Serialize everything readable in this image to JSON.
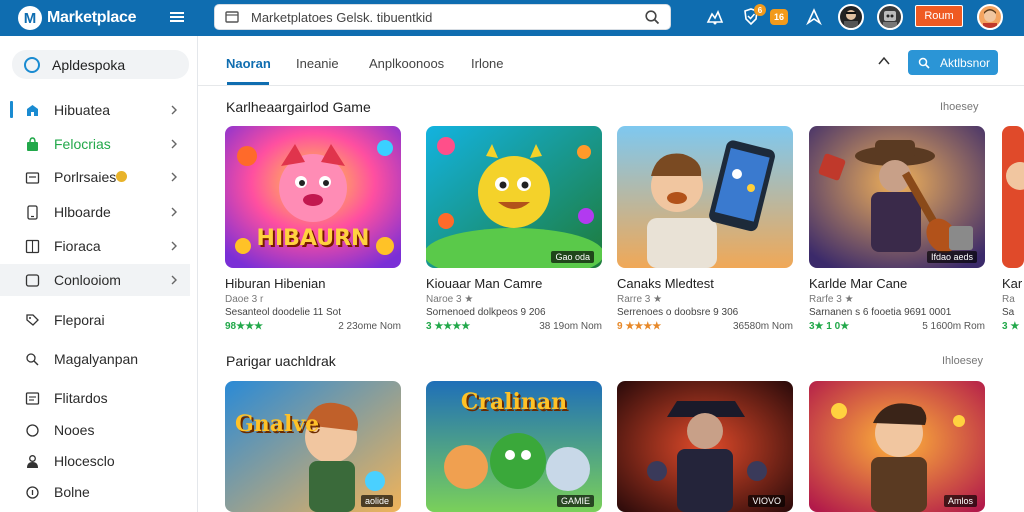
{
  "header": {
    "brand": "Marketplace",
    "logo_letter": "M",
    "search_value": "Marketplatoes    Gelsk. tibuentkid",
    "notif_badge": "6",
    "msg_badge": "16",
    "signin_label": "Roum"
  },
  "sidebar": {
    "top_label": "Apldespoka",
    "items": [
      {
        "label": "Hibuatea"
      },
      {
        "label": "Felocrias"
      },
      {
        "label": "Porlrsaies"
      },
      {
        "label": "Hlboarde"
      },
      {
        "label": "Fioraca"
      },
      {
        "label": "Conlooiom"
      },
      {
        "label": "Fleporai"
      },
      {
        "label": "Magalyanpan"
      },
      {
        "label": "Flitardos"
      },
      {
        "label": "Nooes"
      },
      {
        "label": "Hlocesclo"
      },
      {
        "label": "Bolne"
      }
    ]
  },
  "tabs": [
    {
      "label": "Naoran"
    },
    {
      "label": "Ineanie"
    },
    {
      "label": "Anplkoonoos"
    },
    {
      "label": "Irlone"
    }
  ],
  "action_button": {
    "label": "Aktlbsnor"
  },
  "sections": [
    {
      "title": "Karlheaargairlod Game",
      "link": "Ihoesey",
      "cards": [
        {
          "title": "Hiburan Hibenian",
          "sub": "Daoe 3 r",
          "desc": "Sesanteol doodelie 11 Sot",
          "rating": "98★★★",
          "size": "2 23ome Nom",
          "overlay": "HIBAURN"
        },
        {
          "title": "Kiouaar Man Camre",
          "sub": "Naroe 3 ★",
          "desc": "Sornenoed dolkpeos 9 206",
          "rating": "3 ★★★★",
          "size": "38 19om Nom",
          "tag": "Gao oda"
        },
        {
          "title": "Canaks Mledtest",
          "sub": "Rarre 3 ★",
          "desc": "Serrenoes o doobsre 9 306",
          "rating": "9 ★★★★",
          "size": "36580m Nom"
        },
        {
          "title": "Karlde Mar Cane",
          "sub": "Rarfe 3 ★",
          "desc": "Sarnanen s 6 fooetia 9691 0001",
          "rating": "3★ 1 0★",
          "size": "5 1600m Rom",
          "tag": "Ifdao aeds"
        },
        {
          "title": "Kar",
          "sub": "Ra",
          "desc": "Sa",
          "rating": "3 ★",
          "size": ""
        }
      ]
    },
    {
      "title": "Parigar uachldrak",
      "link": "Ihloesey",
      "cards": [
        {
          "overlay": "Gnalve",
          "tag": "aolide"
        },
        {
          "overlay": "Cralinan",
          "tag": "GAMIE"
        },
        {
          "tag": "VIOVO"
        },
        {
          "tag": "Amlos"
        }
      ]
    }
  ],
  "colors": {
    "brand_blue": "#0f6db0",
    "accent_green": "#22a84a",
    "signin_orange": "#ef5a22",
    "action_blue": "#2b95d6"
  }
}
